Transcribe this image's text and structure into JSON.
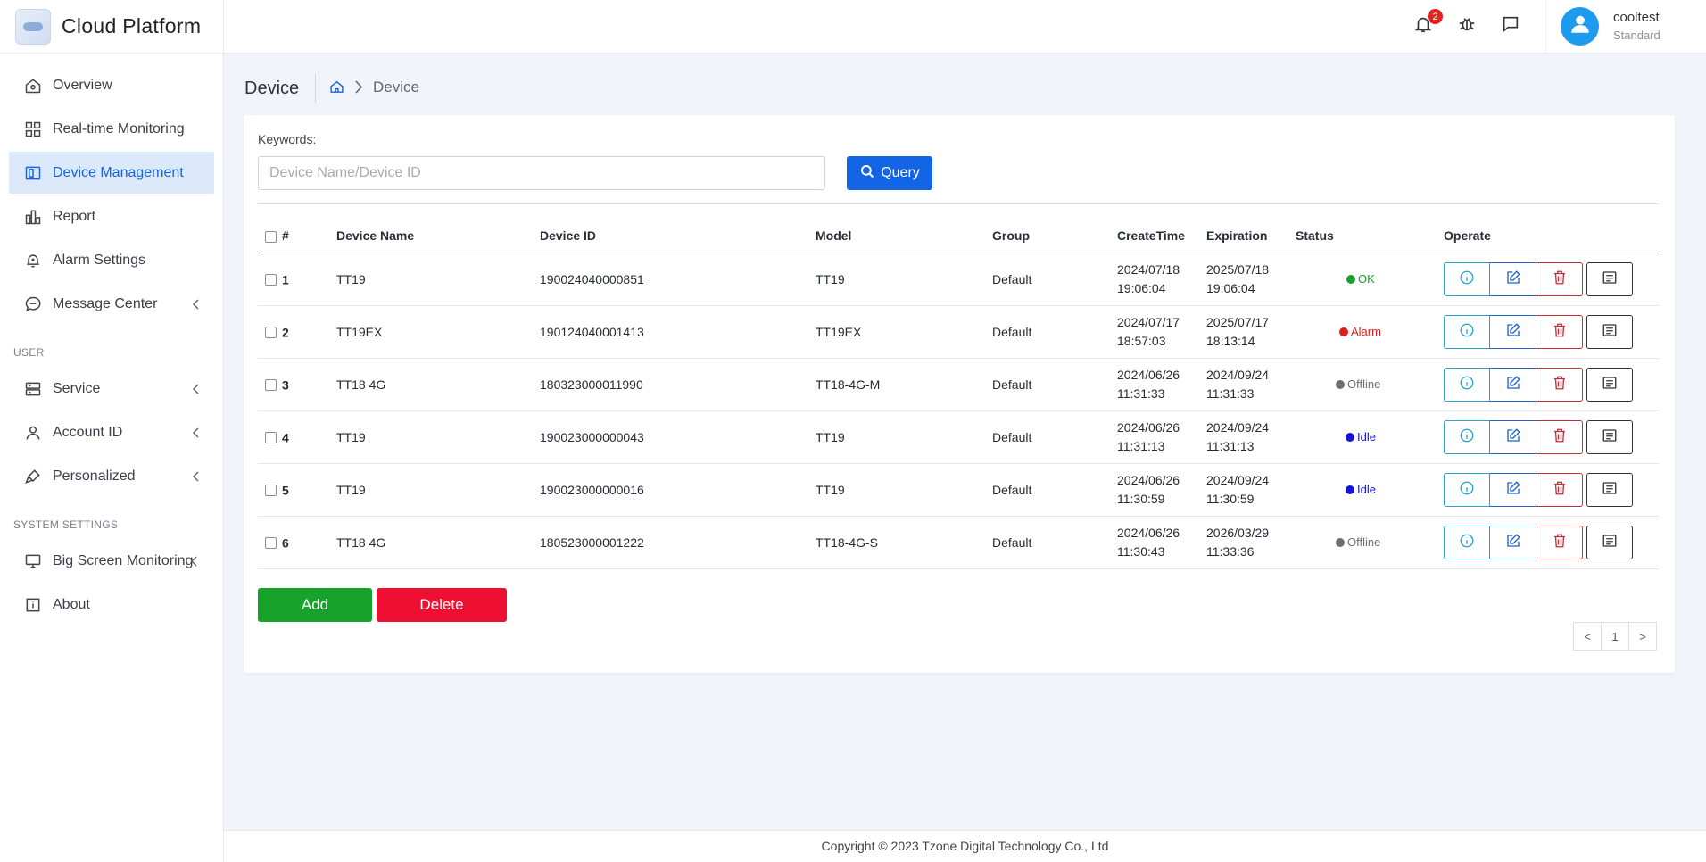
{
  "app": {
    "title": "Cloud Platform"
  },
  "sidebar": {
    "items": [
      {
        "label": "Overview",
        "icon": "home-icon"
      },
      {
        "label": "Real-time Monitoring",
        "icon": "grid-icon"
      },
      {
        "label": "Device Management",
        "icon": "device-icon",
        "active": true
      },
      {
        "label": "Report",
        "icon": "bar-chart-icon"
      },
      {
        "label": "Alarm Settings",
        "icon": "alarm-icon"
      },
      {
        "label": "Message Center",
        "icon": "chat-icon"
      }
    ],
    "user_section": "USER",
    "user_items": [
      {
        "label": "Service",
        "icon": "server-icon"
      },
      {
        "label": "Account ID",
        "icon": "user-icon"
      },
      {
        "label": "Personalized",
        "icon": "brush-icon"
      }
    ],
    "system_section": "SYSTEM SETTINGS",
    "system_items": [
      {
        "label": "Big Screen Monitoring",
        "icon": "monitor-icon"
      },
      {
        "label": "About",
        "icon": "info-icon"
      }
    ]
  },
  "header": {
    "notification_count": "2",
    "user": {
      "name": "cooltest",
      "role": "Standard"
    },
    "accent": "#1d9bef"
  },
  "page": {
    "title": "Device",
    "breadcrumb": "Device"
  },
  "search": {
    "label": "Keywords:",
    "placeholder": "Device Name/Device ID",
    "value": "",
    "query_label": "Query"
  },
  "table": {
    "headers": {
      "index": "#",
      "name": "Device Name",
      "id": "Device ID",
      "model": "Model",
      "group": "Group",
      "create": "CreateTime",
      "expiration": "Expiration",
      "status": "Status",
      "operate": "Operate"
    },
    "rows": [
      {
        "index": "1",
        "name": "TT19",
        "id": "190024040000851",
        "model": "TT19",
        "group": "Default",
        "create_date": "2024/07/18",
        "create_time": "19:06:04",
        "exp_date": "2025/07/18",
        "exp_time": "19:06:04",
        "status": "OK",
        "status_color": "#1a9f2c"
      },
      {
        "index": "2",
        "name": "TT19EX",
        "id": "190124040001413",
        "model": "TT19EX",
        "group": "Default",
        "create_date": "2024/07/17",
        "create_time": "18:57:03",
        "exp_date": "2025/07/17",
        "exp_time": "18:13:14",
        "status": "Alarm",
        "status_color": "#d8201e"
      },
      {
        "index": "3",
        "name": "TT18 4G",
        "id": "180323000011990",
        "model": "TT18-4G-M",
        "group": "Default",
        "create_date": "2024/06/26",
        "create_time": "11:31:33",
        "exp_date": "2024/09/24",
        "exp_time": "11:31:33",
        "status": "Offline",
        "status_color": "#6b7078"
      },
      {
        "index": "4",
        "name": "TT19",
        "id": "190023000000043",
        "model": "TT19",
        "group": "Default",
        "create_date": "2024/06/26",
        "create_time": "11:31:13",
        "exp_date": "2024/09/24",
        "exp_time": "11:31:13",
        "status": "Idle",
        "status_color": "#1414d4"
      },
      {
        "index": "5",
        "name": "TT19",
        "id": "190023000000016",
        "model": "TT19",
        "group": "Default",
        "create_date": "2024/06/26",
        "create_time": "11:30:59",
        "exp_date": "2024/09/24",
        "exp_time": "11:30:59",
        "status": "Idle",
        "status_color": "#1414d4"
      },
      {
        "index": "6",
        "name": "TT18 4G",
        "id": "180523000001222",
        "model": "TT18-4G-S",
        "group": "Default",
        "create_date": "2024/06/26",
        "create_time": "11:30:43",
        "exp_date": "2026/03/29",
        "exp_time": "11:33:36",
        "status": "Offline",
        "status_color": "#6b7078"
      }
    ]
  },
  "actions": {
    "add_label": "Add",
    "delete_label": "Delete"
  },
  "pagination": {
    "prev": "<",
    "current": "1",
    "next": ">"
  },
  "footer": {
    "copyright": "Copyright © 2023 Tzone Digital Technology Co., Ltd"
  }
}
